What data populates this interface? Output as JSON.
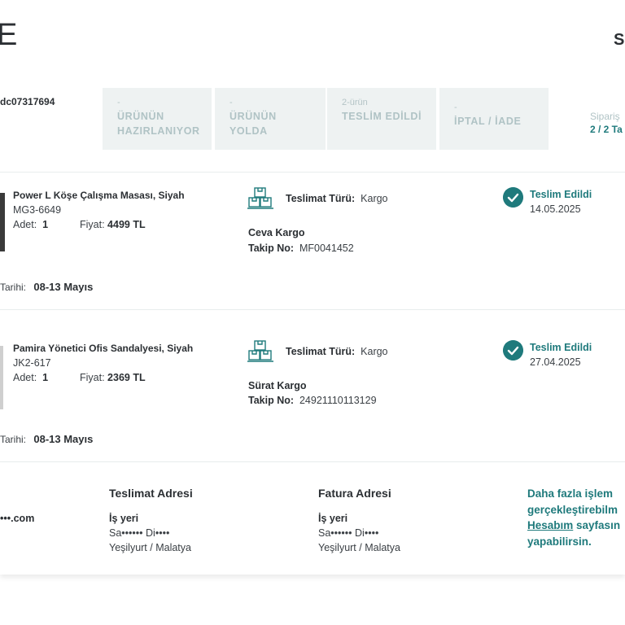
{
  "header": {
    "logo_text": "E",
    "top_right_text": "S"
  },
  "order": {
    "id_text": "dc07317694",
    "steps": [
      {
        "pre": "-",
        "label_1": "ÜRÜNÜN",
        "label_2": "HAZIRLANIYOR"
      },
      {
        "pre": "-",
        "label_1": "ÜRÜNÜN",
        "label_2": "YOLDA"
      },
      {
        "pre": "2-ürün",
        "label_1": "TESLİM EDİLDİ",
        "label_2": ""
      },
      {
        "pre": "-",
        "label_1": "İPTAL / İADE",
        "label_2": ""
      }
    ],
    "summary_pre": "Sipariş",
    "summary_label": "2 / 2 Ta"
  },
  "items": [
    {
      "name": "Power L Köşe Çalışma Masası, Siyah",
      "sku": "MG3-6649",
      "qty_label": "Adet:",
      "qty": "1",
      "price_label": "Fiyat:",
      "price": "4499 TL",
      "ship_type_label": "Teslimat Türü:",
      "ship_type": "Kargo",
      "carrier": "Ceva Kargo",
      "track_label": "Takip No:",
      "track_no": "MF0041452",
      "status": "Teslim Edildi",
      "status_date": "14.05.2025",
      "range_label": "Tarihi:",
      "range": "08-13 Mayıs"
    },
    {
      "name": "Pamira Yönetici Ofis Sandalyesi, Siyah",
      "sku": "JK2-617",
      "qty_label": "Adet:",
      "qty": "1",
      "price_label": "Fiyat:",
      "price": "2369 TL",
      "ship_type_label": "Teslimat Türü:",
      "ship_type": "Kargo",
      "carrier": "Sürat Kargo",
      "track_label": "Takip No:",
      "track_no": "24921110113129",
      "status": "Teslim Edildi",
      "status_date": "27.04.2025",
      "range_label": "Tarihi:",
      "range": "08-13 Mayıs"
    }
  ],
  "bottom": {
    "email": "•••.com",
    "delivery_address": {
      "title": "Teslimat Adresi",
      "line1": "İş yeri",
      "line2": "Sa•••••• Di••••",
      "line3": "Yeşilyurt / Malatya"
    },
    "billing_address": {
      "title": "Fatura Adresi",
      "line1": "İş yeri",
      "line2": "Sa•••••• Di••••",
      "line3": "Yeşilyurt / Malatya"
    },
    "promo": {
      "line1": "Daha fazla işlem",
      "line2": "gerçekleştirebilm",
      "link": "Hesabım",
      "line3_rest": " sayfasın",
      "line4": "yapabilirsin."
    }
  },
  "colors": {
    "accent": "#1f7a7c",
    "step_bg": "#eef2f2",
    "step_text": "#b0c3c5"
  },
  "icons": {
    "shipping": "boxes-on-pallet-icon",
    "status": "check-circle-icon"
  }
}
